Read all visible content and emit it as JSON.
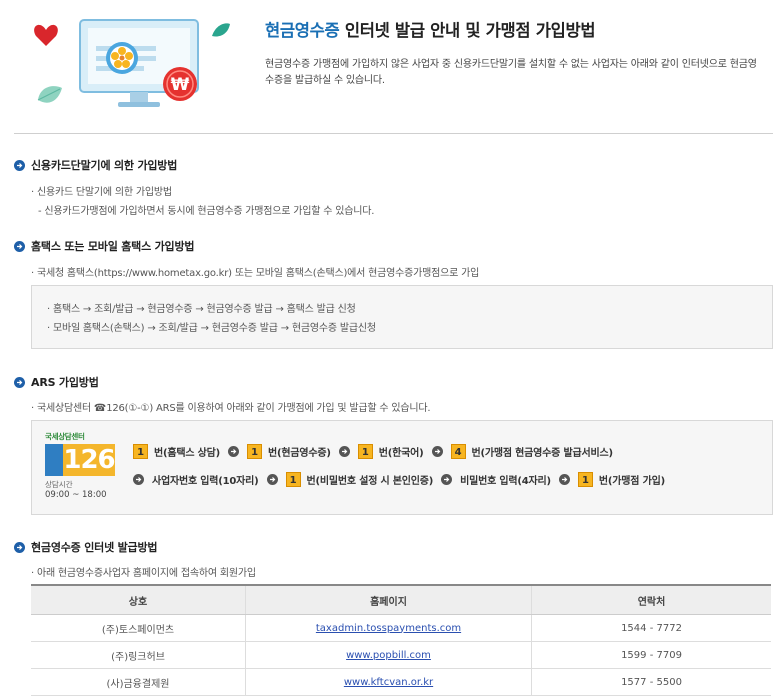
{
  "hero": {
    "title_highlight": "현금영수증",
    "title_rest": " 인터넷 발급 안내 및 가맹점 가입방법",
    "desc": "현금영수증 가맹점에 가입하지 않은 사업자 중 신용카드단말기를 설치할 수 없는 사업자는 아래와 같이 인터넷으로 현금영수증을 발급하실 수 있습니다."
  },
  "sections": {
    "card": {
      "heading": "신용카드단말기에 의한 가입방법",
      "line1": "· 신용카드 단말기에 의한 가입방법",
      "line2": "- 신용카드가맹점에 가입하면서 동시에 현금영수증 가맹점으로 가입할 수 있습니다."
    },
    "hometax": {
      "heading": "홈택스 또는 모바일 홈택스 가입방법",
      "line1": "· 국세청 홈택스(https://www.hometax.go.kr) 또는 모바일 홈택스(손택스)에서 현금영수증가맹점으로 가입",
      "box_line1": "· 홈택스 → 조회/발급 → 현금영수증 → 현금영수증 발급 → 홈택스 발급 신청",
      "box_line2": "· 모바일 홈택스(손택스) → 조회/발급 → 현금영수증 발급 → 현금영수증 발급신청"
    },
    "ars": {
      "heading": "ARS 가입방법",
      "line1": "· 국세상담센터 ☎126(①-①) ARS를 이용하여 아래와 같이 가맹점에 가입 및 발급할 수 있습니다.",
      "logo_caption": "국세상담센터",
      "logo_number": "126",
      "logo_hours_label": "상담시간",
      "logo_hours": "09:00 ~ 18:00",
      "row1": [
        {
          "num": "1",
          "text": "번(홈택스 상담)"
        },
        {
          "num": "1",
          "text": "번(현금영수증)"
        },
        {
          "num": "1",
          "text": "번(한국어)"
        },
        {
          "num": "4",
          "text": "번(가맹점 현금영수증 발급서비스)"
        }
      ],
      "row2_step1": "사업자번호 입력(10자리)",
      "row2_step2_num": "1",
      "row2_step2": "번(비밀번호 설정 시 본인인증)",
      "row2_step3": "비밀번호 입력(4자리)",
      "row2_step4_num": "1",
      "row2_step4": "번(가맹점 가입)"
    },
    "internet": {
      "heading": "현금영수증 인터넷 발급방법",
      "line1": "· 아래 현금영수증사업자 홈페이지에 접속하여 회원가입",
      "table": {
        "headers": [
          "상호",
          "홈페이지",
          "연락처"
        ],
        "rows": [
          [
            "(주)토스페이먼츠",
            "taxadmin.tosspayments.com",
            "1544 - 7772"
          ],
          [
            "(주)링크허브",
            "www.popbill.com",
            "1599 - 7709"
          ],
          [
            "(사)금융결제원",
            "www.kftcvan.or.kr",
            "1577 - 5500"
          ]
        ]
      }
    }
  },
  "colors": {
    "accent": "#1a6fb4",
    "step_number": "#f7b521",
    "bullet": "#1e5fa8"
  }
}
